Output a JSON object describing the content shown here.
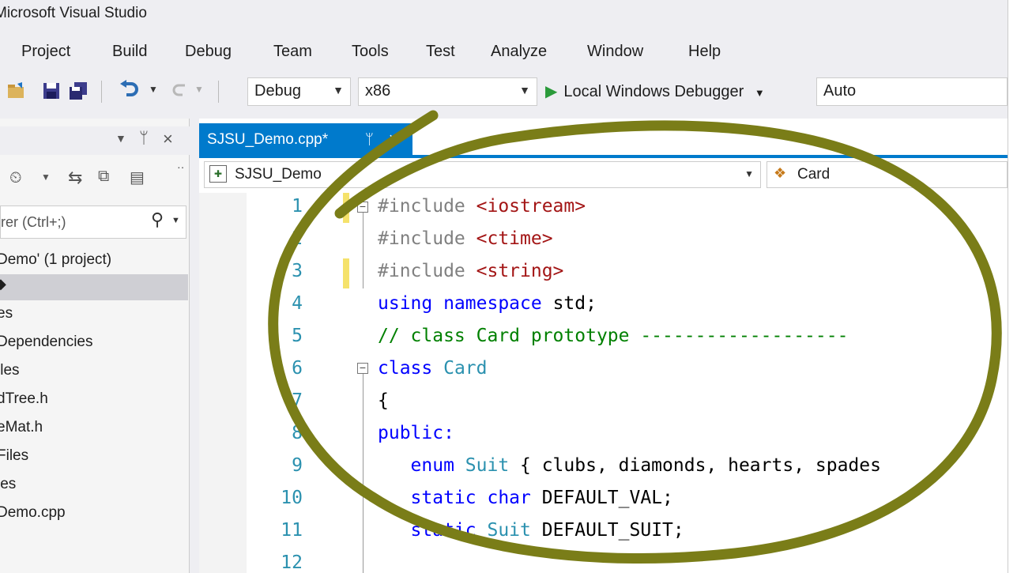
{
  "window": {
    "title": "Microsoft Visual Studio"
  },
  "menu": [
    "Project",
    "Build",
    "Debug",
    "Team",
    "Tools",
    "Test",
    "Analyze",
    "Window",
    "Help"
  ],
  "toolbar": {
    "config": "Debug",
    "platform": "x86",
    "debugger": "Local Windows Debugger",
    "debugger_option": "Auto"
  },
  "solution_explorer": {
    "search_placeholder": "rer (Ctrl+;)",
    "items": [
      "Demo' (1 project)",
      "es",
      "Dependencies",
      "iles",
      "dTree.h",
      "eMat.h",
      "Files",
      "les",
      "Demo.cpp"
    ]
  },
  "editor": {
    "tab_label": "SJSU_Demo.cpp*",
    "nav_project": "SJSU_Demo",
    "nav_scope": "Card",
    "line_numbers": [
      "1",
      "2",
      "3",
      "4",
      "5",
      "6",
      "7",
      "8",
      "9",
      "10",
      "11",
      "12"
    ],
    "lines": [
      [
        {
          "t": "#include ",
          "c": "pp"
        },
        {
          "t": "<iostream>",
          "c": "inc"
        }
      ],
      [
        {
          "t": "#include ",
          "c": "pp"
        },
        {
          "t": "<ctime>",
          "c": "inc"
        }
      ],
      [
        {
          "t": "#include ",
          "c": "pp"
        },
        {
          "t": "<string>",
          "c": "inc"
        }
      ],
      [
        {
          "t": "using namespace ",
          "c": "kw"
        },
        {
          "t": "std;",
          "c": "plain"
        }
      ],
      [
        {
          "t": "// class Card prototype -------------------",
          "c": "cm"
        }
      ],
      [
        {
          "t": "class ",
          "c": "kw"
        },
        {
          "t": "Card",
          "c": "tp"
        }
      ],
      [
        {
          "t": "{",
          "c": "plain"
        }
      ],
      [
        {
          "t": "public:",
          "c": "kw"
        }
      ],
      [
        {
          "t": "   enum ",
          "c": "kw"
        },
        {
          "t": "Suit",
          "c": "tp"
        },
        {
          "t": " { clubs, diamonds, hearts, spades",
          "c": "plain"
        }
      ],
      [
        {
          "t": "   static char ",
          "c": "kw"
        },
        {
          "t": "DEFAULT_VAL;",
          "c": "plain"
        }
      ],
      [
        {
          "t": "   static ",
          "c": "kw"
        },
        {
          "t": "Suit",
          "c": "tp"
        },
        {
          "t": " DEFAULT_SUIT;",
          "c": "plain"
        }
      ],
      []
    ]
  },
  "colors": {
    "accent": "#007acc",
    "annotation": "#7a7d18"
  }
}
